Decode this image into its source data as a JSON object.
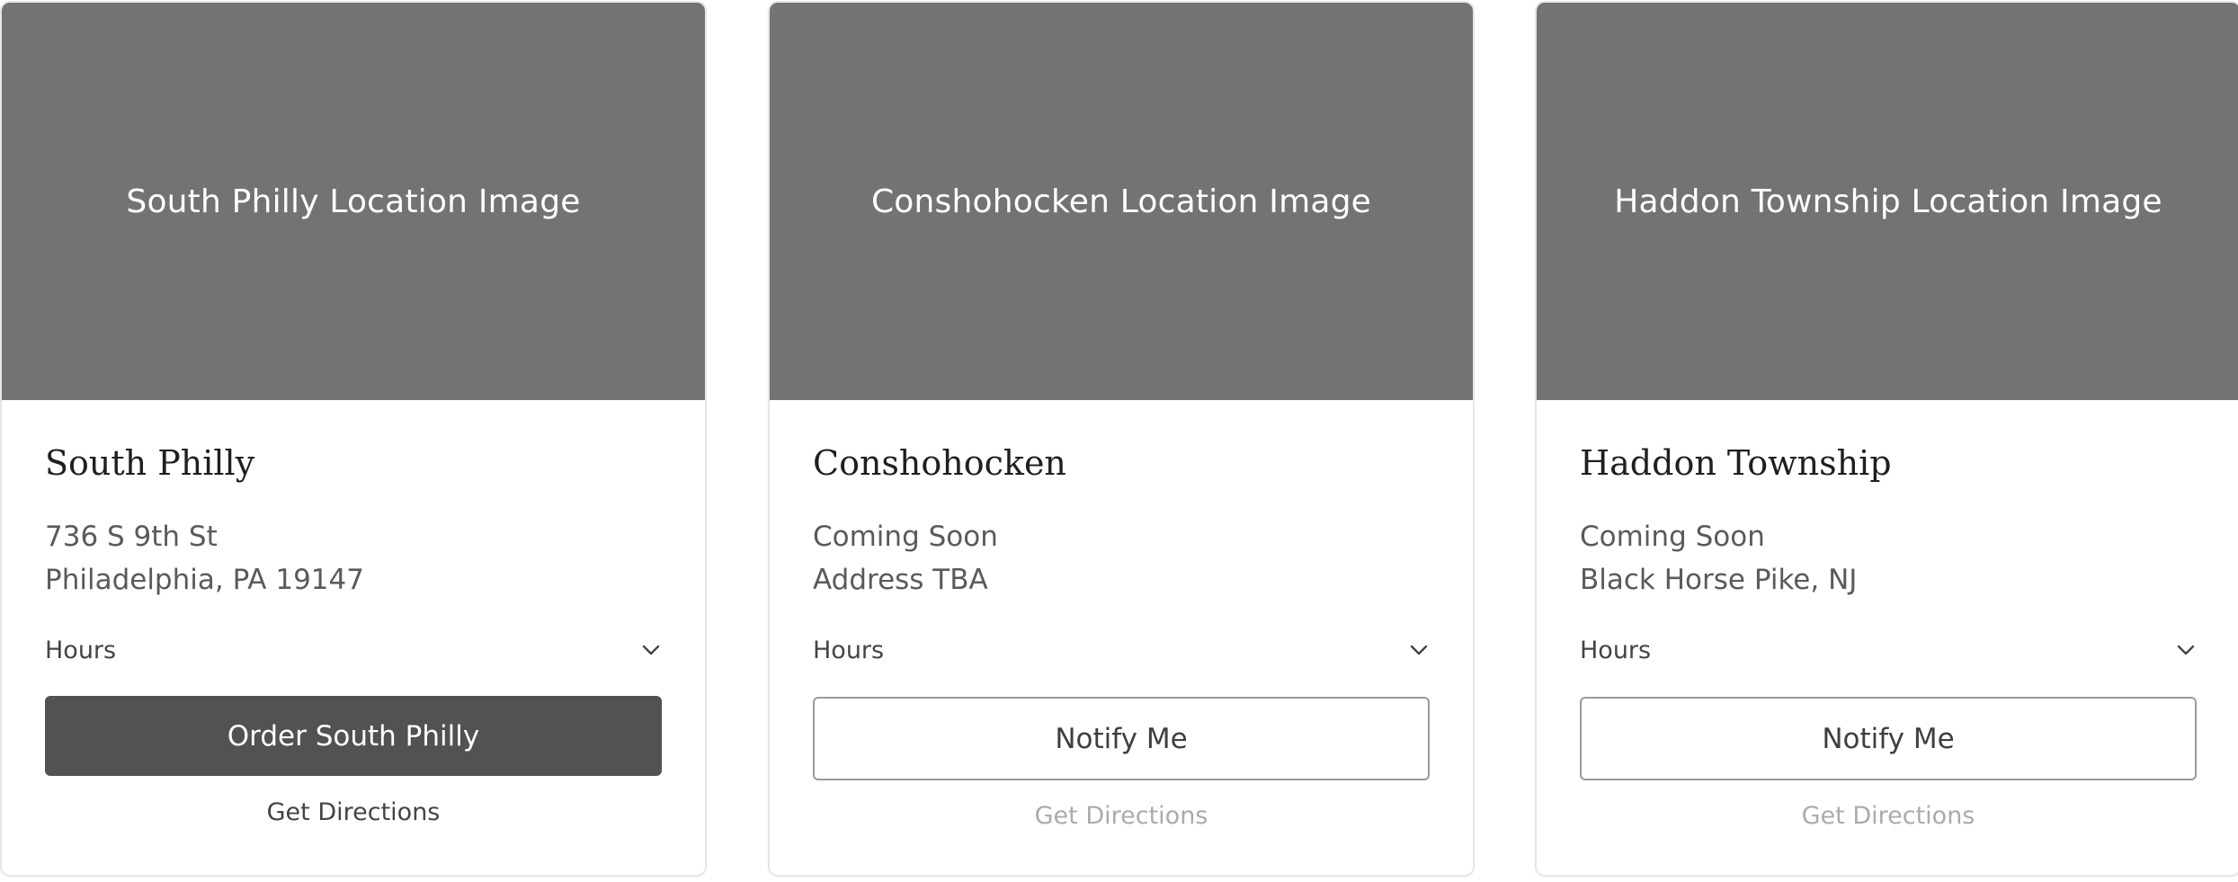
{
  "locations": [
    {
      "image_label": "South Philly Location Image",
      "name": "South Philly",
      "line1": "736 S 9th St",
      "line2": "Philadelphia, PA 19147",
      "hours_label": "Hours",
      "button_label": "Order South Philly",
      "button_style": "primary",
      "directions_label": "Get Directions",
      "directions_enabled": true
    },
    {
      "image_label": "Conshohocken Location Image",
      "name": "Conshohocken",
      "line1": "Coming Soon",
      "line2": "Address TBA",
      "hours_label": "Hours",
      "button_label": "Notify Me",
      "button_style": "outline",
      "directions_label": "Get Directions",
      "directions_enabled": false
    },
    {
      "image_label": "Haddon Township Location Image",
      "name": "Haddon Township",
      "line1": "Coming Soon",
      "line2": "Black Horse Pike, NJ",
      "hours_label": "Hours",
      "button_label": "Notify Me",
      "button_style": "outline",
      "directions_label": "Get Directions",
      "directions_enabled": false
    }
  ],
  "icons": {
    "hours_toggle": "chevron-down-icon"
  },
  "colors": {
    "image_placeholder": "#737373",
    "primary_button": "#525252",
    "muted_text": "#ababab"
  }
}
